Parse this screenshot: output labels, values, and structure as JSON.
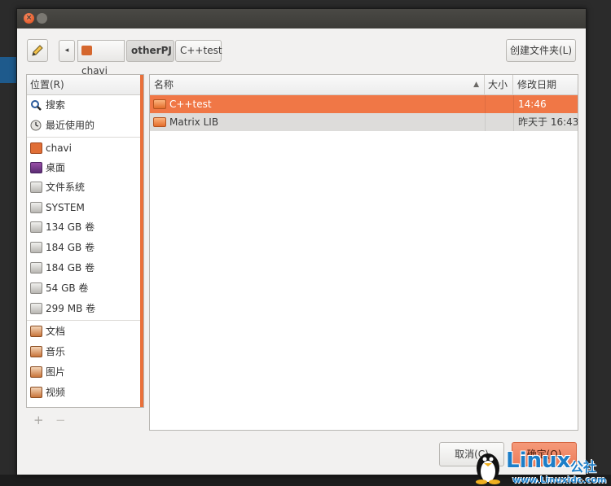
{
  "toolbar": {
    "edit_icon": "pencil-icon",
    "crumb_back": "◂",
    "crumbs": [
      "chavi",
      "otherPJ",
      "C++test"
    ],
    "new_folder": "创建文件夹(L)"
  },
  "sidebar": {
    "header": "位置(R)",
    "items": [
      {
        "label": "搜索",
        "icon": "search-icon"
      },
      {
        "label": "最近使用的",
        "icon": "recent-icon"
      },
      {
        "label": "chavi",
        "icon": "home-icon"
      },
      {
        "label": "桌面",
        "icon": "desktop-icon"
      },
      {
        "label": "文件系统",
        "icon": "drive-icon"
      },
      {
        "label": "SYSTEM",
        "icon": "drive-icon"
      },
      {
        "label": "134 GB 卷",
        "icon": "drive-icon"
      },
      {
        "label": "184 GB 卷",
        "icon": "drive-icon"
      },
      {
        "label": "184 GB 卷",
        "icon": "drive-icon"
      },
      {
        "label": "54 GB 卷",
        "icon": "drive-icon"
      },
      {
        "label": "299 MB 卷",
        "icon": "drive-icon"
      },
      {
        "label": "文档",
        "icon": "documents-icon"
      },
      {
        "label": "音乐",
        "icon": "music-icon"
      },
      {
        "label": "图片",
        "icon": "pictures-icon"
      },
      {
        "label": "视频",
        "icon": "videos-icon"
      }
    ],
    "add": "+",
    "remove": "−"
  },
  "filelist": {
    "columns": {
      "name": "名称",
      "size": "大小",
      "modified": "修改日期"
    },
    "rows": [
      {
        "name": "C++test",
        "size": "",
        "modified": "14:46"
      },
      {
        "name": "Matrix LIB",
        "size": "",
        "modified": "昨天于 16:43"
      }
    ]
  },
  "buttons": {
    "cancel": "取消(C)",
    "ok": "确定(O)"
  },
  "watermark": {
    "brand": "Linux",
    "suffix": "公社",
    "url": "www.Linuxidc.com"
  },
  "colors": {
    "accent": "#f07746",
    "selected_text": "#ffffff",
    "watermark": "#1d7ec8"
  }
}
